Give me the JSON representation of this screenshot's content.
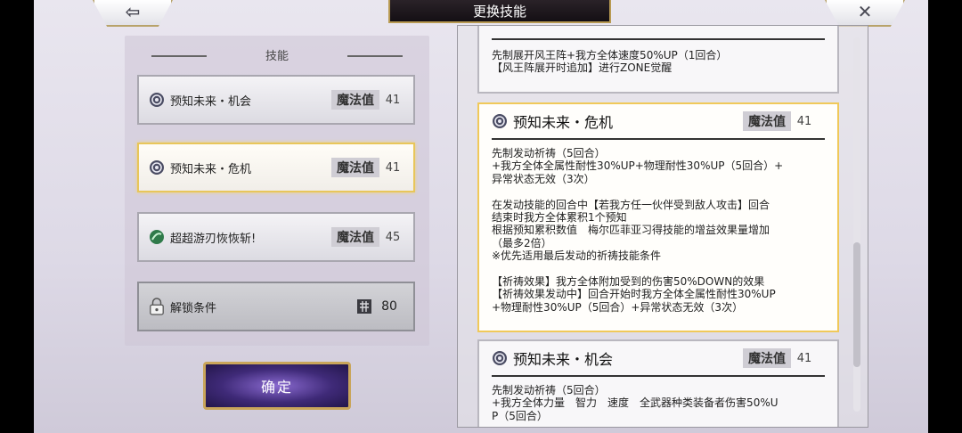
{
  "header": {
    "title": "更换技能",
    "back_glyph": "⇦",
    "close_glyph": "✕"
  },
  "left": {
    "header": "技能",
    "mp_label": "魔法值",
    "skills": [
      {
        "name": "预知未来・机会",
        "mp": "41",
        "icon": "lotus-icon"
      },
      {
        "name": "预知未来・危机",
        "mp": "41",
        "icon": "lotus-icon"
      },
      {
        "name": "超超游刃恢恢斩!",
        "mp": "45",
        "icon": "green-orb-icon"
      }
    ],
    "lock": {
      "label": "解锁条件",
      "cost": "80",
      "icon": "lock-icon",
      "currency_icon": "stamp-icon"
    },
    "confirm": "确定"
  },
  "right": {
    "partial_card": {
      "lines": "先制展开风王阵+我方全体速度50%UP（1回合）\n【风王阵展开时追加】进行ZONE觉醒"
    },
    "selected_card": {
      "name": "预知未来・危机",
      "mp_label": "魔法值",
      "mp": "41",
      "text": "先制发动祈祷（5回合）\n+我方全体全属性耐性30%UP+物理耐性30%UP（5回合）+\n异常状态无效（3次）\n\n在发动技能的回合中【若我方任一伙伴受到敌人攻击】回合\n结束时我方全体累积1个预知\n根据预知累积数值　梅尔匹菲亚习得技能的增益效果量增加\n（最多2倍）\n※优先适用最后发动的祈祷技能条件\n\n【祈祷效果】我方全体附加受到的伤害50%DOWN的效果\n【祈祷效果发动中】回合开始时我方全体全属性耐性30%UP\n+物理耐性30%UP（5回合）+异常状态无效（3次）"
    },
    "bottom_card": {
      "name": "预知未来・机会",
      "mp_label": "魔法值",
      "mp": "41",
      "text": "先制发动祈祷（5回合）\n+我方全体力量　智力　速度　全武器种类装备者伤害50%U\nP（5回合）"
    }
  }
}
